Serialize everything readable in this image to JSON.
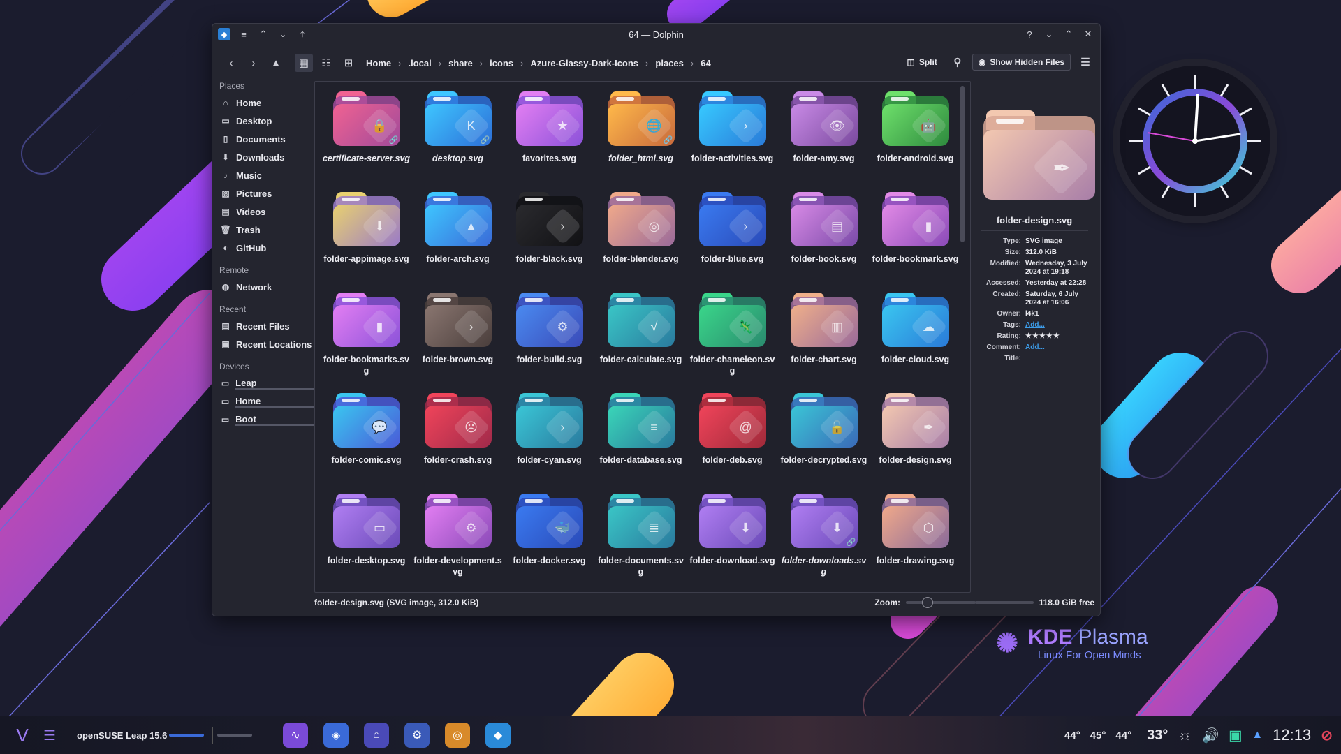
{
  "window": {
    "title": "64 — Dolphin",
    "titlebar_left_icons": [
      "dolphin-app-icon",
      "menu-icon",
      "chevron-up-icon",
      "chevron-down-icon",
      "keep-above-icon"
    ],
    "titlebar_right_icons": [
      "help-icon",
      "minimize-icon",
      "maximize-icon",
      "close-icon"
    ]
  },
  "toolbar": {
    "breadcrumbs": [
      "Home",
      ".local",
      "share",
      "icons",
      "Azure-Glassy-Dark-Icons",
      "places",
      "64"
    ],
    "split_label": "Split",
    "show_hidden_label": "Show Hidden Files"
  },
  "sidebar": {
    "places_title": "Places",
    "places": [
      {
        "label": "Home",
        "icon": "home-icon"
      },
      {
        "label": "Desktop",
        "icon": "desktop-icon"
      },
      {
        "label": "Documents",
        "icon": "documents-icon"
      },
      {
        "label": "Downloads",
        "icon": "downloads-icon"
      },
      {
        "label": "Music",
        "icon": "music-icon"
      },
      {
        "label": "Pictures",
        "icon": "pictures-icon"
      },
      {
        "label": "Videos",
        "icon": "videos-icon"
      },
      {
        "label": "Trash",
        "icon": "trash-icon"
      },
      {
        "label": "GitHub",
        "icon": "github-icon"
      }
    ],
    "remote_title": "Remote",
    "remote": [
      {
        "label": "Network",
        "icon": "network-icon"
      }
    ],
    "recent_title": "Recent",
    "recent": [
      {
        "label": "Recent Files",
        "icon": "recent-files-icon"
      },
      {
        "label": "Recent Locations",
        "icon": "recent-locations-icon"
      }
    ],
    "devices_title": "Devices",
    "devices": [
      {
        "label": "Leap",
        "icon": "drive-icon"
      },
      {
        "label": "Home",
        "icon": "drive-icon"
      },
      {
        "label": "Boot",
        "icon": "drive-icon"
      }
    ]
  },
  "files": [
    {
      "name": "certificate-server.svg",
      "italic": true,
      "link": true,
      "colors": [
        "#f06292",
        "#a04a9a"
      ],
      "symbol": "🔒"
    },
    {
      "name": "desktop.svg",
      "italic": true,
      "link": true,
      "colors": [
        "#3ec6ff",
        "#2d6fd8"
      ],
      "symbol": "K"
    },
    {
      "name": "favorites.svg",
      "italic": false,
      "link": false,
      "colors": [
        "#e27ef2",
        "#8b52d9"
      ],
      "symbol": "★"
    },
    {
      "name": "folder_html.svg",
      "italic": true,
      "link": true,
      "colors": [
        "#ffb94a",
        "#c86a3c"
      ],
      "symbol": "🌐"
    },
    {
      "name": "folder-activities.svg",
      "italic": false,
      "link": false,
      "colors": [
        "#37c9ff",
        "#2a7ad8"
      ],
      "symbol": "›"
    },
    {
      "name": "folder-amy.svg",
      "italic": false,
      "link": false,
      "colors": [
        "#c98ae6",
        "#7a4a9e"
      ],
      "symbol": "👁"
    },
    {
      "name": "folder-android.svg",
      "italic": false,
      "link": false,
      "colors": [
        "#6ee06b",
        "#2e8a3e"
      ],
      "symbol": "🤖"
    },
    {
      "name": "folder-appimage.svg",
      "italic": false,
      "link": false,
      "colors": [
        "#e8d070",
        "#9a7ac8"
      ],
      "symbol": "⬇"
    },
    {
      "name": "folder-arch.svg",
      "italic": false,
      "link": false,
      "colors": [
        "#3ec6ff",
        "#3a6ad8"
      ],
      "symbol": "▲"
    },
    {
      "name": "folder-black.svg",
      "italic": false,
      "link": false,
      "colors": [
        "#2a2a2e",
        "#111114"
      ],
      "symbol": "›"
    },
    {
      "name": "folder-blender.svg",
      "italic": false,
      "link": false,
      "colors": [
        "#f0a98a",
        "#9a6a9a"
      ],
      "symbol": "◎"
    },
    {
      "name": "folder-blue.svg",
      "italic": false,
      "link": false,
      "colors": [
        "#3a7af0",
        "#2a4ab8"
      ],
      "symbol": "›"
    },
    {
      "name": "folder-book.svg",
      "italic": false,
      "link": false,
      "colors": [
        "#d88ae6",
        "#7a4aa8"
      ],
      "symbol": "▤"
    },
    {
      "name": "folder-bookmark.svg",
      "italic": false,
      "link": false,
      "colors": [
        "#e28ae6",
        "#8a4ab8"
      ],
      "symbol": "▮"
    },
    {
      "name": "folder-bookmarks.svg",
      "italic": false,
      "link": false,
      "colors": [
        "#e27ef2",
        "#8b52d9"
      ],
      "symbol": "▮"
    },
    {
      "name": "folder-brown.svg",
      "italic": false,
      "link": false,
      "colors": [
        "#8a7670",
        "#4a3e3c"
      ],
      "symbol": "›"
    },
    {
      "name": "folder-build.svg",
      "italic": false,
      "link": false,
      "colors": [
        "#4a8af0",
        "#3a4ab8"
      ],
      "symbol": "⚙"
    },
    {
      "name": "folder-calculate.svg",
      "italic": false,
      "link": false,
      "colors": [
        "#3ac6c6",
        "#2a7a9e"
      ],
      "symbol": "√"
    },
    {
      "name": "folder-chameleon.svg",
      "italic": false,
      "link": false,
      "colors": [
        "#3ad68a",
        "#2a8a6e"
      ],
      "symbol": "🦎"
    },
    {
      "name": "folder-chart.svg",
      "italic": false,
      "link": false,
      "colors": [
        "#f0b08a",
        "#9a6a9a"
      ],
      "symbol": "▥"
    },
    {
      "name": "folder-cloud.svg",
      "italic": false,
      "link": false,
      "colors": [
        "#3ac6f0",
        "#2a7ad8"
      ],
      "symbol": "☁"
    },
    {
      "name": "folder-comic.svg",
      "italic": false,
      "link": false,
      "colors": [
        "#3ac6f0",
        "#4a5ad8"
      ],
      "symbol": "💬"
    },
    {
      "name": "folder-crash.svg",
      "italic": false,
      "link": false,
      "colors": [
        "#f0445a",
        "#a02a4a"
      ],
      "symbol": "☹"
    },
    {
      "name": "folder-cyan.svg",
      "italic": false,
      "link": false,
      "colors": [
        "#3ac6d6",
        "#2a7a9e"
      ],
      "symbol": "›"
    },
    {
      "name": "folder-database.svg",
      "italic": false,
      "link": false,
      "colors": [
        "#3ad6b8",
        "#2a7a9e"
      ],
      "symbol": "≡"
    },
    {
      "name": "folder-deb.svg",
      "italic": false,
      "link": false,
      "colors": [
        "#f0445a",
        "#a02a3a"
      ],
      "symbol": "@"
    },
    {
      "name": "folder-decrypted.svg",
      "italic": false,
      "link": false,
      "colors": [
        "#3ac6d6",
        "#3a6ab8"
      ],
      "symbol": "🔓"
    },
    {
      "name": "folder-design.svg",
      "italic": false,
      "link": false,
      "colors": [
        "#f3c8b0",
        "#a87ea8"
      ],
      "symbol": "✒"
    },
    {
      "name": "folder-desktop.svg",
      "italic": false,
      "link": false,
      "colors": [
        "#b07ef2",
        "#6a4ab8"
      ],
      "symbol": "▭"
    },
    {
      "name": "folder-development.svg",
      "italic": false,
      "link": false,
      "colors": [
        "#e27ef2",
        "#8a4ab8"
      ],
      "symbol": "⚙"
    },
    {
      "name": "folder-docker.svg",
      "italic": false,
      "link": false,
      "colors": [
        "#3a7af0",
        "#2a4ab8"
      ],
      "symbol": "🐳"
    },
    {
      "name": "folder-documents.svg",
      "italic": false,
      "link": false,
      "colors": [
        "#3ac6c6",
        "#2a7a9e"
      ],
      "symbol": "≣"
    },
    {
      "name": "folder-download.svg",
      "italic": false,
      "link": false,
      "colors": [
        "#b07ef2",
        "#6a4ab8"
      ],
      "symbol": "⬇"
    },
    {
      "name": "folder-downloads.svg",
      "italic": true,
      "link": true,
      "colors": [
        "#b07ef2",
        "#6a4ab8"
      ],
      "symbol": "⬇"
    },
    {
      "name": "folder-drawing.svg",
      "italic": false,
      "link": false,
      "colors": [
        "#f0a98a",
        "#8a6a9a"
      ],
      "symbol": "⬡"
    }
  ],
  "selected_file": "folder-design.svg",
  "info_panel": {
    "title": "folder-design.svg",
    "properties": [
      {
        "key": "Type:",
        "value": "SVG image"
      },
      {
        "key": "Size:",
        "value": "312.0 KiB"
      },
      {
        "key": "Modified:",
        "value": "Wednesday, 3 July 2024 at 19:18"
      },
      {
        "key": "Accessed:",
        "value": "Yesterday at 22:28"
      },
      {
        "key": "Created:",
        "value": "Saturday, 6 July 2024 at 16:06"
      },
      {
        "key": "Owner:",
        "value": "l4k1"
      },
      {
        "key": "Tags:",
        "value": "Add..."
      },
      {
        "key": "Rating:",
        "value": "★★★★★"
      },
      {
        "key": "Comment:",
        "value": "Add..."
      },
      {
        "key": "Title:",
        "value": ""
      }
    ]
  },
  "statusbar": {
    "selection_text": "folder-design.svg (SVG image, 312.0 KiB)",
    "zoom_label": "Zoom:",
    "zoom_fraction": 0.3,
    "free_space": "118.0 GiB free"
  },
  "desktop": {
    "kde_title_kde": "KDE",
    "kde_title_plasma": " Plasma",
    "kde_subtitle": "Linux For Open Minds"
  },
  "taskbar": {
    "activity_label": "openSUSE Leap 15.6",
    "apps": [
      {
        "name": "system-monitor-icon",
        "color": "#7a4ad8"
      },
      {
        "name": "discover-icon",
        "color": "#3a6ad8"
      },
      {
        "name": "shop-icon",
        "color": "#4a4ab8"
      },
      {
        "name": "settings-icon",
        "color": "#3a5ab8"
      },
      {
        "name": "firefox-icon",
        "color": "#d88a2a"
      },
      {
        "name": "dolphin-icon",
        "color": "#2a8ad8"
      }
    ],
    "temps": [
      "44°",
      "45°",
      "44°"
    ],
    "weather": "33°",
    "time": "12:13"
  },
  "colors": {
    "accent": "#3d9dea",
    "window_bg": "#24252f",
    "desktop_bg": "#1b1c2e"
  }
}
